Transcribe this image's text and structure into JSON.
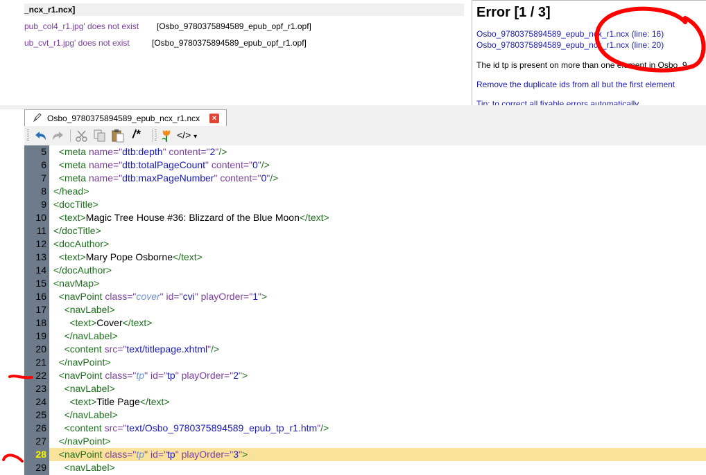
{
  "messages": {
    "header": "_ncx_r1.ncx]",
    "rows": [
      {
        "text": "pub_col4_r1.jpg' does not exist",
        "file": "[Osbo_9780375894589_epub_opf_r1.opf]"
      },
      {
        "text": "ub_cvt_r1.jpg' does not exist",
        "file": "[Osbo_9780375894589_epub_opf_r1.opf]"
      }
    ]
  },
  "error_panel": {
    "title": "Error [1 / 3]",
    "links": [
      "Osbo_9780375894589_epub_ncx_r1.ncx (line: 16)",
      "Osbo_9780375894589_epub_ncx_r1.ncx (line: 20)"
    ],
    "message": "The id tp is present on more than one element in Osbo_9",
    "fix": "Remove the duplicate ids from all but the first element",
    "tip": "Tip: to correct all fixable errors automatically"
  },
  "tab": {
    "filename": "Osbo_9780375894589_epub_ncx_r1.ncx",
    "close": "×"
  },
  "toolbar": {
    "comment": "/*",
    "code": "</>",
    "code_caret": "▾"
  },
  "colors": {
    "gutter": "#6e7b8b",
    "highlight": "#fbe29b",
    "tag": "#1f6f1f",
    "attr": "#7a3e9d",
    "value": "#1a1ab5",
    "annotation": "#ff0000"
  },
  "code": {
    "highlight_line": 28,
    "lines": [
      {
        "n": "5",
        "indent": "  ",
        "parts": [
          [
            "t",
            "<meta "
          ],
          [
            "a",
            "name="
          ],
          [
            "a",
            "\""
          ],
          [
            "v",
            "dtb:depth"
          ],
          [
            "a",
            "\""
          ],
          [
            "a",
            " content="
          ],
          [
            "a",
            "\""
          ],
          [
            "v",
            "2"
          ],
          [
            "a",
            "\""
          ],
          [
            "t",
            "/>"
          ]
        ]
      },
      {
        "n": "6",
        "indent": "  ",
        "parts": [
          [
            "t",
            "<meta "
          ],
          [
            "a",
            "name="
          ],
          [
            "a",
            "\""
          ],
          [
            "v",
            "dtb:totalPageCount"
          ],
          [
            "a",
            "\""
          ],
          [
            "a",
            " content="
          ],
          [
            "a",
            "\""
          ],
          [
            "v",
            "0"
          ],
          [
            "a",
            "\""
          ],
          [
            "t",
            "/>"
          ]
        ]
      },
      {
        "n": "7",
        "indent": "  ",
        "parts": [
          [
            "t",
            "<meta "
          ],
          [
            "a",
            "name="
          ],
          [
            "a",
            "\""
          ],
          [
            "v",
            "dtb:maxPageNumber"
          ],
          [
            "a",
            "\""
          ],
          [
            "a",
            " content="
          ],
          [
            "a",
            "\""
          ],
          [
            "v",
            "0"
          ],
          [
            "a",
            "\""
          ],
          [
            "t",
            "/>"
          ]
        ]
      },
      {
        "n": "8",
        "indent": "",
        "parts": [
          [
            "t",
            "</head>"
          ]
        ]
      },
      {
        "n": "9",
        "indent": "",
        "parts": [
          [
            "t",
            "<docTitle>"
          ]
        ]
      },
      {
        "n": "10",
        "indent": "  ",
        "parts": [
          [
            "t",
            "<text>"
          ],
          [
            "x",
            "Magic Tree House #36: Blizzard of the Blue Moon"
          ],
          [
            "t",
            "</text>"
          ]
        ]
      },
      {
        "n": "11",
        "indent": "",
        "parts": [
          [
            "t",
            "</docTitle>"
          ]
        ]
      },
      {
        "n": "12",
        "indent": "",
        "parts": [
          [
            "t",
            "<docAuthor>"
          ]
        ]
      },
      {
        "n": "13",
        "indent": "  ",
        "parts": [
          [
            "t",
            "<text>"
          ],
          [
            "x",
            "Mary Pope Osborne"
          ],
          [
            "t",
            "</text>"
          ]
        ]
      },
      {
        "n": "14",
        "indent": "",
        "parts": [
          [
            "t",
            "</docAuthor>"
          ]
        ]
      },
      {
        "n": "15",
        "indent": "",
        "parts": [
          [
            "t",
            "<navMap>"
          ]
        ]
      },
      {
        "n": "16",
        "indent": "  ",
        "parts": [
          [
            "t",
            "<navPoint "
          ],
          [
            "a",
            "class="
          ],
          [
            "a",
            "\""
          ],
          [
            "vi",
            "cover"
          ],
          [
            "a",
            "\""
          ],
          [
            "a",
            " id="
          ],
          [
            "a",
            "\""
          ],
          [
            "v",
            "cvi"
          ],
          [
            "a",
            "\""
          ],
          [
            "a",
            " playOrder="
          ],
          [
            "a",
            "\""
          ],
          [
            "v",
            "1"
          ],
          [
            "a",
            "\""
          ],
          [
            "t",
            ">"
          ]
        ]
      },
      {
        "n": "17",
        "indent": "    ",
        "parts": [
          [
            "t",
            "<navLabel>"
          ]
        ]
      },
      {
        "n": "18",
        "indent": "      ",
        "parts": [
          [
            "t",
            "<text>"
          ],
          [
            "x",
            "Cover"
          ],
          [
            "t",
            "</text>"
          ]
        ]
      },
      {
        "n": "19",
        "indent": "    ",
        "parts": [
          [
            "t",
            "</navLabel>"
          ]
        ]
      },
      {
        "n": "20",
        "indent": "    ",
        "parts": [
          [
            "t",
            "<content "
          ],
          [
            "a",
            "src="
          ],
          [
            "a",
            "\""
          ],
          [
            "v",
            "text/titlepage.xhtml"
          ],
          [
            "a",
            "\""
          ],
          [
            "t",
            "/>"
          ]
        ]
      },
      {
        "n": "21",
        "indent": "  ",
        "parts": [
          [
            "t",
            "</navPoint>"
          ]
        ]
      },
      {
        "n": "22",
        "indent": "  ",
        "parts": [
          [
            "t",
            "<navPoint "
          ],
          [
            "a",
            "class="
          ],
          [
            "a",
            "\""
          ],
          [
            "vi",
            "tp"
          ],
          [
            "a",
            "\""
          ],
          [
            "a",
            " id="
          ],
          [
            "a",
            "\""
          ],
          [
            "v",
            "tp"
          ],
          [
            "a",
            "\""
          ],
          [
            "a",
            " playOrder="
          ],
          [
            "a",
            "\""
          ],
          [
            "v",
            "2"
          ],
          [
            "a",
            "\""
          ],
          [
            "t",
            ">"
          ]
        ]
      },
      {
        "n": "23",
        "indent": "    ",
        "parts": [
          [
            "t",
            "<navLabel>"
          ]
        ]
      },
      {
        "n": "24",
        "indent": "      ",
        "parts": [
          [
            "t",
            "<text>"
          ],
          [
            "x",
            "Title Page"
          ],
          [
            "t",
            "</text>"
          ]
        ]
      },
      {
        "n": "25",
        "indent": "    ",
        "parts": [
          [
            "t",
            "</navLabel>"
          ]
        ]
      },
      {
        "n": "26",
        "indent": "    ",
        "parts": [
          [
            "t",
            "<content "
          ],
          [
            "a",
            "src="
          ],
          [
            "a",
            "\""
          ],
          [
            "v",
            "text/Osbo_9780375894589_epub_tp_r1.htm"
          ],
          [
            "a",
            "\""
          ],
          [
            "t",
            "/>"
          ]
        ]
      },
      {
        "n": "27",
        "indent": "  ",
        "parts": [
          [
            "t",
            "</navPoint>"
          ]
        ]
      },
      {
        "n": "28",
        "indent": "  ",
        "parts": [
          [
            "t",
            "<navPoint "
          ],
          [
            "a",
            "class="
          ],
          [
            "a",
            "\""
          ],
          [
            "vi",
            "tp"
          ],
          [
            "a",
            "\""
          ],
          [
            "a",
            " id="
          ],
          [
            "a",
            "\""
          ],
          [
            "v",
            "tp"
          ],
          [
            "a",
            "\""
          ],
          [
            "a",
            " playOrder="
          ],
          [
            "a",
            "\""
          ],
          [
            "v",
            "3"
          ],
          [
            "a",
            "\""
          ],
          [
            "t",
            ">"
          ]
        ]
      },
      {
        "n": "29",
        "indent": "    ",
        "parts": [
          [
            "t",
            "<navLabel>"
          ]
        ]
      }
    ]
  }
}
